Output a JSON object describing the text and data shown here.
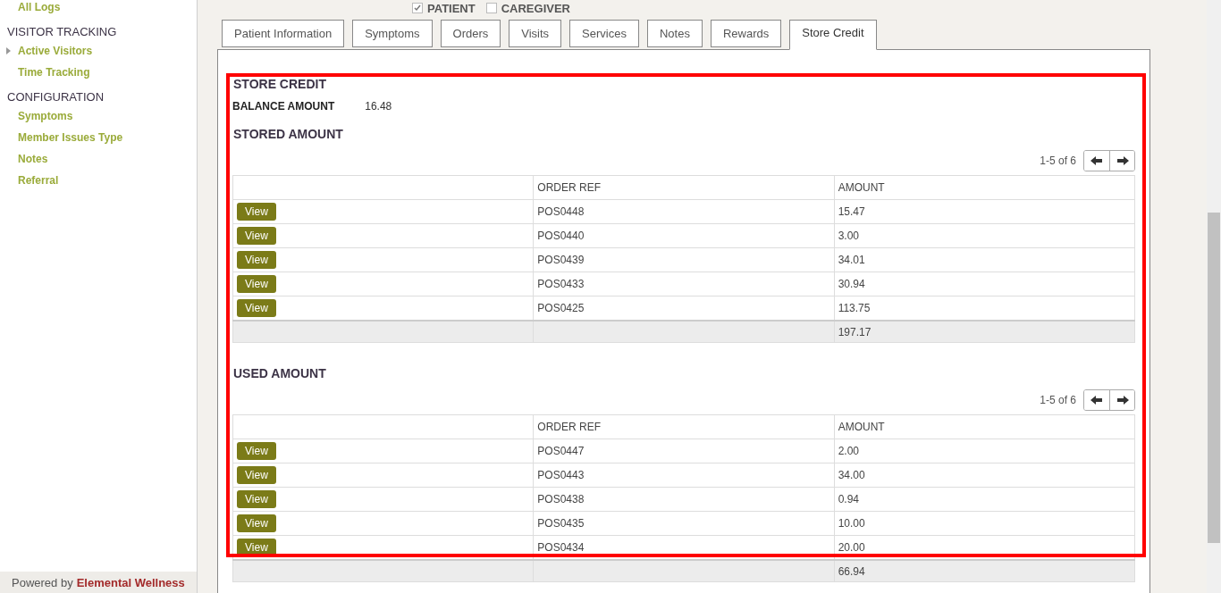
{
  "sidebar": {
    "top_items": [
      {
        "label": "All Logs"
      }
    ],
    "sections": [
      {
        "title": "VISITOR TRACKING",
        "items": [
          {
            "label": "Active Visitors",
            "expanded": false
          },
          {
            "label": "Time Tracking"
          }
        ]
      },
      {
        "title": "CONFIGURATION",
        "items": [
          {
            "label": "Symptoms"
          },
          {
            "label": "Member Issues Type"
          },
          {
            "label": "Notes"
          },
          {
            "label": "Referral"
          }
        ]
      }
    ],
    "footer": {
      "prefix": "Powered by",
      "brand": "Elemental Wellness"
    }
  },
  "member_type": [
    {
      "label": "PATIENT",
      "checked": true
    },
    {
      "label": "CAREGIVER",
      "checked": false
    }
  ],
  "tabs": [
    {
      "label": "Patient Information",
      "selected": false
    },
    {
      "label": "Symptoms",
      "selected": false
    },
    {
      "label": "Orders",
      "selected": false
    },
    {
      "label": "Visits",
      "selected": false
    },
    {
      "label": "Services",
      "selected": false
    },
    {
      "label": "Notes",
      "selected": false
    },
    {
      "label": "Rewards",
      "selected": false
    },
    {
      "label": "Store Credit",
      "selected": true
    }
  ],
  "store_credit": {
    "title": "STORE CREDIT",
    "balance_label": "BALANCE AMOUNT",
    "balance_value": "16.48",
    "tables": [
      {
        "title": "STORED AMOUNT",
        "pager": "1-5 of 6",
        "columns": [
          "ORDER REF",
          "AMOUNT"
        ],
        "rows": [
          {
            "action": "View",
            "order_ref": "POS0448",
            "amount": "15.47"
          },
          {
            "action": "View",
            "order_ref": "POS0440",
            "amount": "3.00"
          },
          {
            "action": "View",
            "order_ref": "POS0439",
            "amount": "34.01"
          },
          {
            "action": "View",
            "order_ref": "POS0433",
            "amount": "30.94"
          },
          {
            "action": "View",
            "order_ref": "POS0425",
            "amount": "113.75"
          }
        ],
        "total": "197.17"
      },
      {
        "title": "USED AMOUNT",
        "pager": "1-5 of 6",
        "columns": [
          "ORDER REF",
          "AMOUNT"
        ],
        "rows": [
          {
            "action": "View",
            "order_ref": "POS0447",
            "amount": "2.00"
          },
          {
            "action": "View",
            "order_ref": "POS0443",
            "amount": "34.00"
          },
          {
            "action": "View",
            "order_ref": "POS0438",
            "amount": "0.94"
          },
          {
            "action": "View",
            "order_ref": "POS0435",
            "amount": "10.00"
          },
          {
            "action": "View",
            "order_ref": "POS0434",
            "amount": "20.00"
          }
        ],
        "total": "66.94"
      }
    ]
  }
}
